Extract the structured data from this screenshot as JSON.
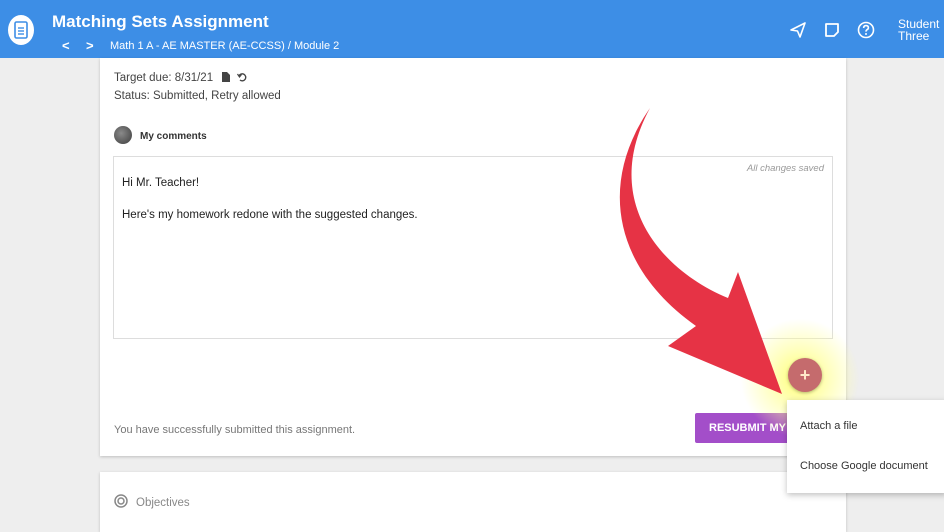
{
  "header": {
    "title": "Matching Sets Assignment",
    "breadcrumb": "Math 1 A - AE MASTER (AE-CCSS) / Module 2",
    "prev_arrow": "<",
    "next_arrow": ">",
    "user_first": "Student",
    "user_last": "Three",
    "icons": [
      "document-icon",
      "send-icon",
      "note-icon",
      "help-icon"
    ]
  },
  "assignment": {
    "target_due": "Target due: 8/31/21",
    "status": "Status: Submitted, Retry allowed",
    "comments_label": "My comments",
    "autosave": "All changes saved",
    "comment_lines": [
      "Hi Mr. Teacher!",
      "Here's my homework redone with the suggested changes."
    ],
    "success_message": "You have successfully submitted this assignment.",
    "resubmit_label": "RESUBMIT MY"
  },
  "fab": {
    "symbol": "+"
  },
  "attach_menu": {
    "items": [
      "Attach a file",
      "Choose Google document"
    ]
  },
  "objectives": {
    "label": "Objectives"
  },
  "colors": {
    "header": "#3d8ee6",
    "resubmit": "#a34ec9",
    "fab": "#c56b6d",
    "annotation_arrow": "#e63345"
  }
}
